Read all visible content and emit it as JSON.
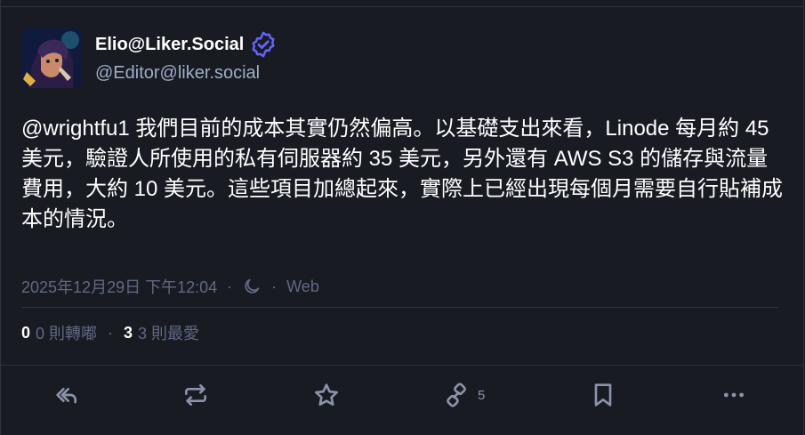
{
  "account": {
    "display_name": "Elio@Liker.Social",
    "handle": "@Editor@liker.social"
  },
  "post": {
    "mention": "@wrightfu1",
    "text": " 我們目前的成本其實仍然偏高。以基礎支出來看，Linode 每月約 45 美元，驗證人所使用的私有伺服器約 35 美元，另外還有 AWS S3 的儲存與流量費用，大約 10 美元。這些項目加總起來，實際上已經出現每個月需要自行貼補成本的情況。"
  },
  "meta": {
    "timestamp": "2025年12月29日 下午12:04",
    "separator": "·",
    "visibility_icon": "moon-icon",
    "source": "Web"
  },
  "stats": {
    "reblogs_count": "0",
    "reblogs_label": "0 則轉嘟",
    "favourites_count": "3",
    "favourites_label": "3 則最愛",
    "separator": "·"
  },
  "actions": {
    "quote_count": "5",
    "icons": [
      "reply-icon",
      "boost-icon",
      "favourite-icon",
      "quote-icon",
      "bookmark-icon",
      "more-icon"
    ]
  },
  "colors": {
    "background": "#191b22",
    "border": "#2f3140",
    "secondary_text": "#9baec8",
    "muted_text": "#606984",
    "verified": "#6364ff",
    "action_icon": "#8b93ab"
  }
}
